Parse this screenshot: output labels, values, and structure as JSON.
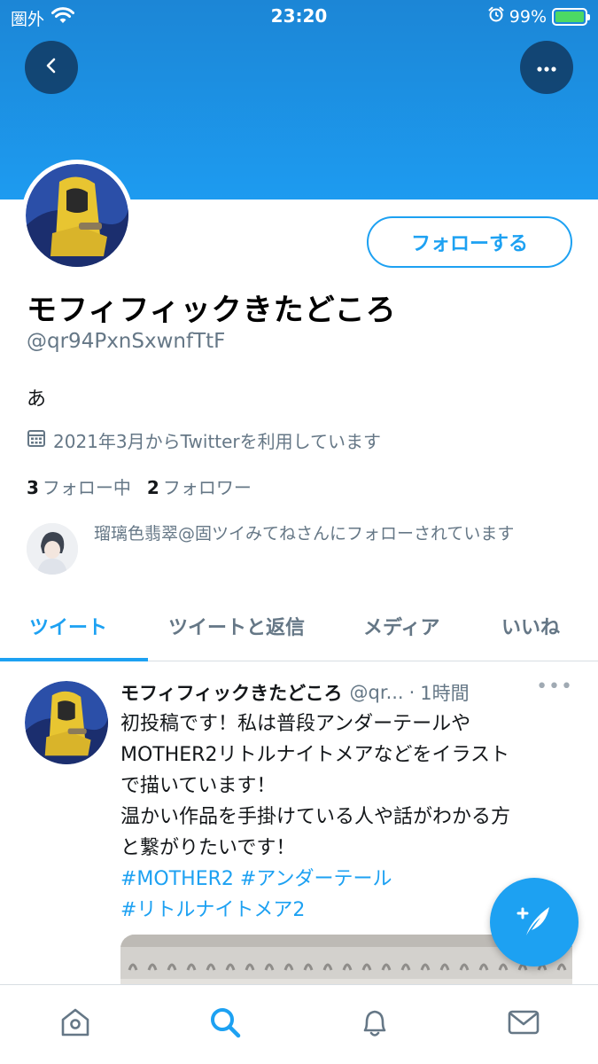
{
  "status_bar": {
    "carrier": "圏外",
    "time": "23:20",
    "battery_percent": "99%"
  },
  "header": {
    "back_icon": "chevron-left-icon",
    "more_icon": "ellipsis-icon"
  },
  "profile": {
    "follow_button_label": "フォローする",
    "display_name": "モフィフィックきたどころ",
    "handle": "@qr94PxnSxwnfTtF",
    "bio": "あ",
    "joined": "2021年3月からTwitterを利用しています",
    "following_count": "3",
    "following_label": "フォロー中",
    "followers_count": "2",
    "followers_label": "フォロワー",
    "followed_by_text": "瑠璃色翡翠@固ツイみてねさんにフォローされています"
  },
  "tabs": [
    {
      "label": "ツイート",
      "active": true
    },
    {
      "label": "ツイートと返信",
      "active": false
    },
    {
      "label": "メディア",
      "active": false
    },
    {
      "label": "いいね",
      "active": false
    }
  ],
  "tweet": {
    "name": "モフィフィックきたどころ",
    "handle": "@qr...",
    "separator": "·",
    "time": "1時間",
    "more": "•••",
    "lines": [
      "初投稿です！私は普段アンダーテールや",
      "MOTHER2リトルナイトメアなどをイラスト",
      "で描いています！",
      "温かい作品を手掛けている人や話がわかる方",
      "と繋がりたいです！"
    ],
    "hashtags_line1": "#MOTHER2 #アンダーテール",
    "hashtags_line2": "#リトルナイトメア2"
  },
  "colors": {
    "accent": "#1da1f2",
    "banner": "#1c8fe0",
    "secondary_text": "#657786"
  },
  "bottom_nav": [
    {
      "icon": "home-icon"
    },
    {
      "icon": "search-icon"
    },
    {
      "icon": "bell-icon"
    },
    {
      "icon": "mail-icon"
    }
  ]
}
